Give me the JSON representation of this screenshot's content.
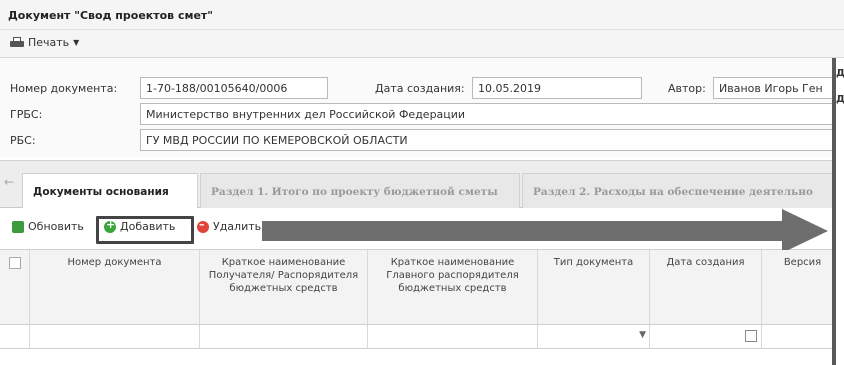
{
  "window": {
    "title": "Документ \"Свод проектов смет\""
  },
  "print_menu": {
    "label": "Печать",
    "icon": "printer-icon"
  },
  "form": {
    "doc_number": {
      "label": "Номер документа:",
      "value": "1-70-188/00105640/0006"
    },
    "created": {
      "label": "Дата создания:",
      "value": "10.05.2019"
    },
    "author": {
      "label": "Автор:",
      "value": "Иванов Игорь Ген"
    },
    "grbs": {
      "label": "ГРБС:",
      "value": "Министерство внутренних дел Российской Федерации"
    },
    "rbs": {
      "label": "РБС:",
      "value": "ГУ МВД РОССИИ ПО КЕМЕРОВСКОЙ ОБЛАСТИ"
    }
  },
  "tabs": [
    {
      "label": "Документы основания",
      "active": true
    },
    {
      "label": "Раздел 1. Итого по проекту бюджетной сметы",
      "active": false
    },
    {
      "label": "Раздел 2. Расходы на обеспечение деятельно",
      "active": false
    }
  ],
  "toolbar": {
    "refresh_label": "Обновить",
    "add_label": "Добавить",
    "delete_label": "Удалить"
  },
  "grid": {
    "columns": [
      "Номер документа",
      "Краткое наименование Получателя/ Распорядителя бюджетных средств",
      "Краткое наименование Главного распорядителя бюджетных средств",
      "Тип документа",
      "Дата создания",
      "Версия"
    ]
  },
  "right_panel": {
    "char1": "Д",
    "char2": "Д"
  }
}
